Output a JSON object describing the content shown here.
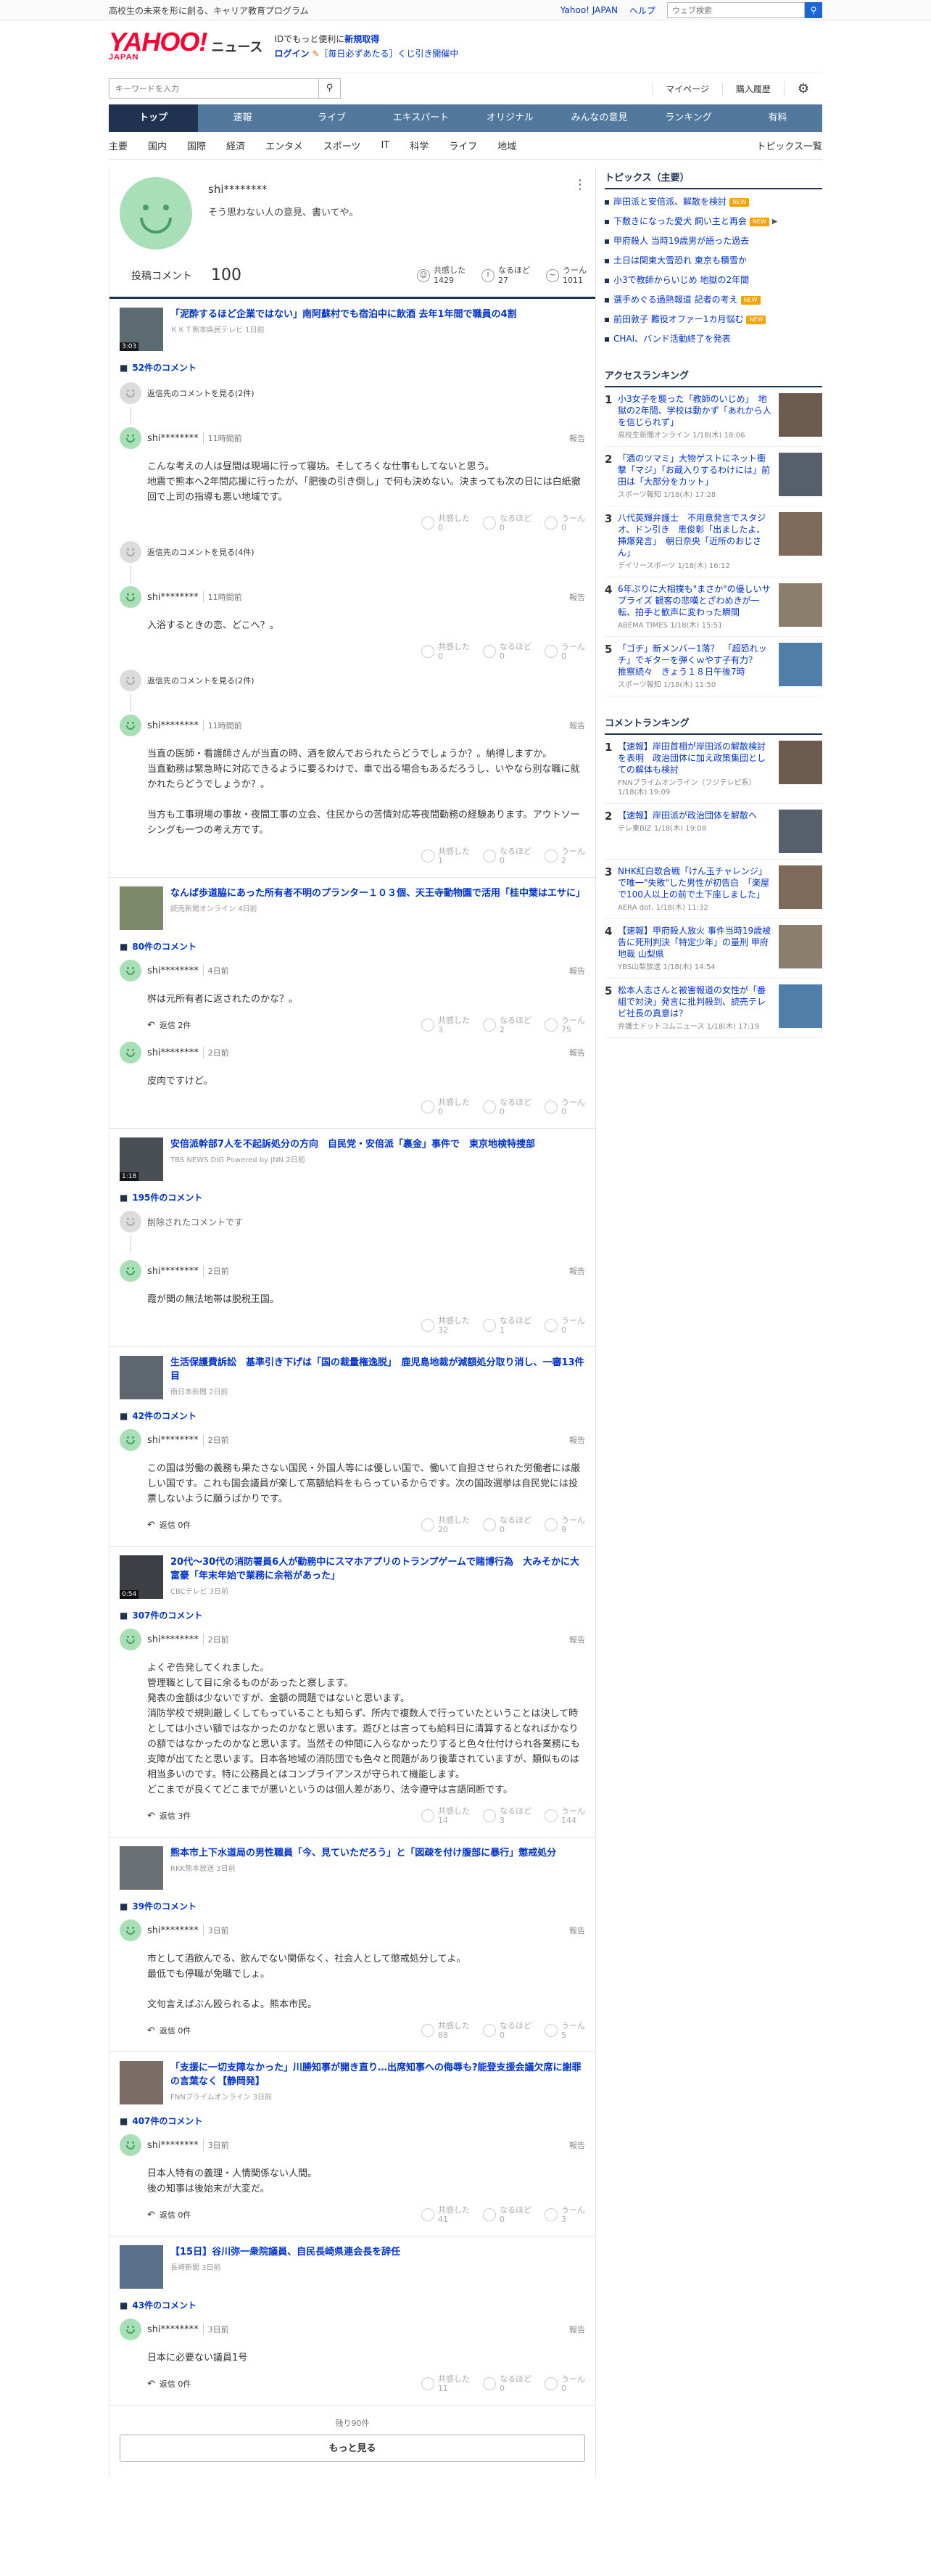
{
  "topbar": {
    "promo": "高校生の未来を形に創る、キャリア教育プログラム",
    "yahoo_japan": "Yahoo! JAPAN",
    "help": "ヘルプ",
    "search_placeholder": "ウェブ検索",
    "search_icon": "search-icon"
  },
  "header": {
    "logo": "YAHOO!",
    "logo_sub": "JAPAN",
    "service": "ニュース",
    "line1_pre": "IDでもっと便利に",
    "line1_link": "新規取得",
    "line2_login": "ログイン",
    "line2_rest": "［毎日必ずあたる］くじ引き開催中"
  },
  "utility": {
    "keyword_placeholder": "キーワードを入力",
    "mypage": "マイページ",
    "follow": "購入履歴",
    "settings_icon": "gear-icon"
  },
  "nav": [
    "トップ",
    "速報",
    "ライブ",
    "エキスパート",
    "オリジナル",
    "みんなの意見",
    "ランキング",
    "有料"
  ],
  "subnav": [
    "主要",
    "国内",
    "国際",
    "経済",
    "エンタメ",
    "スポーツ",
    "IT",
    "科学",
    "ライフ",
    "地域"
  ],
  "subnav_all": "トピックス一覧",
  "profile": {
    "name": "shi********",
    "desc": "そう思わない人の意見、書いてや。"
  },
  "stats": {
    "label": "投稿コメント",
    "count": "100",
    "r1": "共感した",
    "r1v": "1429",
    "r2": "なるほど",
    "r2v": "27",
    "r3": "うーん",
    "r3v": "1011"
  },
  "labels": {
    "report": "報告",
    "r1": "共感した",
    "r2": "なるほど",
    "r3": "うーん",
    "see_replies": "返信先のコメントを見る"
  },
  "blocks": [
    {
      "title": "「泥酔するほど企業ではない」南阿蘇村でも宿泊中に飲酒 去年1年間で職員の4割",
      "source": "ＫＫＴ熊本県民テレビ 1日前",
      "video": "3:03",
      "count": "52件のコメント",
      "thumb": "#5c6a72",
      "comments": [
        {
          "parent": "返信先のコメントを見る(2件)",
          "name": "shi********",
          "time": "11時間前",
          "body": "こんな考えの人は昼間は現場に行って寝坊。そしてろくな仕事もしてないと思う。\n地震で熊本へ2年間応援に行ったが、「肥後の引き倒し」で何も決めない。決まっても次の日には白紙撤回で上司の指導も悪い地域です。",
          "reply": "",
          "v1": "0",
          "v2": "0",
          "v3": "0"
        },
        {
          "parent": "返信先のコメントを見る(4件)",
          "name": "shi********",
          "time": "11時間前",
          "body": "入浴するときの恋、どこへ？。",
          "reply": "",
          "v1": "0",
          "v2": "0",
          "v3": "0"
        },
        {
          "parent": "返信先のコメントを見る(2件)",
          "name": "shi********",
          "time": "11時間前",
          "body": "当直の医師・看護師さんが当直の時、酒を飲んでおられたらどうでしょうか？。納得しますか。\n当直勤務は緊急時に対応できるように要るわけで、車で出る場合もあるだろうし、いやなら別な職に就かれたらどうでしょうか？。\n\n当方も工事現場の事故・夜間工事の立会、住民からの苦情対応等夜間勤務の経験あります。アウトソーシングも一つの考え方です。",
          "reply": "",
          "v1": "1",
          "v2": "0",
          "v3": "2"
        }
      ]
    },
    {
      "title": "なんば歩道脇にあった所有者不明のプランター１０３個、天王寺動物園で活用「桂中葉はエサに」",
      "source": "読売新聞オンライン 4日前",
      "video": "",
      "count": "80件のコメント",
      "thumb": "#7c8a6b",
      "comments": [
        {
          "parent": "",
          "name": "shi********",
          "time": "4日前",
          "body": "桝は元所有者に返されたのかな？。",
          "reply": "返信 2件",
          "v1": "3",
          "v2": "2",
          "v3": "75"
        },
        {
          "parent": "",
          "name": "shi********",
          "time": "2日前",
          "body": "皮肉ですけど。",
          "reply": "",
          "v1": "0",
          "v2": "0",
          "v3": "0"
        }
      ]
    },
    {
      "title": "安倍派幹部7人を不起訴処分の方向　自民党・安倍派「裏金」事件で　東京地検特捜部",
      "source": "TBS NEWS DIG Powered by JNN 2日前",
      "video": "1:18",
      "count": "195件のコメント",
      "thumb": "#4a4f55",
      "deleted": "削除されたコメントです",
      "comments": [
        {
          "parent": "",
          "name": "shi********",
          "time": "2日前",
          "body": "霞が関の無法地帯は脱税王国。",
          "reply": "",
          "v1": "32",
          "v2": "1",
          "v3": "0"
        }
      ]
    },
    {
      "title": "生活保護費訴訟　基準引き下げは「国の裁量権逸脱」　鹿児島地裁が減額処分取り消し、一審13件目",
      "source": "南日本新聞 2日前",
      "video": "",
      "count": "42件のコメント",
      "thumb": "#5e6670",
      "comments": [
        {
          "parent": "",
          "name": "shi********",
          "time": "2日前",
          "body": "この国は労働の義務も果たさない国民・外国人等には優しい国で、働いて自担させられた労働者には厳しい国です。これも国会議員が楽して高額給料をもらっているからです。次の国政選挙は自民党には投票しないように願うばかりです。",
          "reply": "返信 0件",
          "v1": "20",
          "v2": "0",
          "v3": "9"
        }
      ]
    },
    {
      "title": "20代〜30代の消防署員6人が勤務中にスマホアプリのトランプゲームで賭博行為　大みそかに大富豪「年末年始で業務に余裕があった」",
      "source": "CBCテレビ 3日前",
      "video": "0:54",
      "count": "307件のコメント",
      "thumb": "#3c3f44",
      "comments": [
        {
          "parent": "",
          "name": "shi********",
          "time": "2日前",
          "body": "よくぞ告発してくれました。\n管理職として目に余るものがあったと察します。\n発表の金額は少ないですが、金額の問題ではないと思います。\n消防学校で規則厳しくしてもっていることも知らず、所内で複数人で行っていたということは決して時としては小さい額ではなかったのかなと思います。遊びとは言っても給料日に清算するとなればかなりの額ではなかったのかなと思います。当然その仲間に入らなかったりすると色々仕付けられ各業務にも支障が出てたと思います。日本各地域の消防団でも色々と問題があり後輩されていますが、類似ものは相当多いのです。特に公務員とはコンプライアンスが守られて機能します。\nどこまでが良くてどこまでが悪いというのは個人差があり、法令遵守は言語同断です。",
          "reply": "返信 3件",
          "v1": "14",
          "v2": "3",
          "v3": "144"
        }
      ]
    },
    {
      "title": "熊本市上下水道局の男性職員「今、見ていただろう」と「図疎を付け腹部に暴行」懲戒処分",
      "source": "RKK熊本放送 3日前",
      "video": "",
      "count": "39件のコメント",
      "thumb": "#6b7075",
      "comments": [
        {
          "parent": "",
          "name": "shi********",
          "time": "3日前",
          "body": "市として酒飲んでる、飲んでない関係なく、社会人として懲戒処分してよ。\n最低でも停職が免職でしょ。\n\n文句言えばぶん殴られるよ。熊本市民。",
          "reply": "返信 0件",
          "v1": "88",
          "v2": "0",
          "v3": "5"
        }
      ]
    },
    {
      "title": "「支援に一切支障なかった」川勝知事が開き直り…出席知事への侮辱も?能登支援会議欠席に謝罪の言葉なく【静岡発】",
      "source": "FNNプライムオンライン 3日前",
      "video": "",
      "count": "407件のコメント",
      "thumb": "#7a6e66",
      "comments": [
        {
          "parent": "",
          "name": "shi********",
          "time": "3日前",
          "body": "日本人特有の義理・人情関係ない人間。\n後の知事は後始末が大変だ。",
          "reply": "返信 0件",
          "v1": "41",
          "v2": "0",
          "v3": "3"
        }
      ]
    },
    {
      "title": "【15日】谷川弥一衆院議員、自民長崎県連会長を辞任",
      "source": "長崎新聞 3日前",
      "video": "",
      "count": "43件のコメント",
      "thumb": "#58708a",
      "comments": [
        {
          "parent": "",
          "name": "shi********",
          "time": "3日前",
          "body": "日本に必要ない議員1号",
          "reply": "返信 0件",
          "v1": "11",
          "v2": "0",
          "v3": "0"
        }
      ]
    }
  ],
  "more": {
    "remaining": "残り90件",
    "button": "もっと見る"
  },
  "side": {
    "topics_head": "トピックス（主要）",
    "topics": [
      {
        "t": "岸田派と安倍派、解散を検討",
        "new": "NEW",
        "vid": ""
      },
      {
        "t": "下敷きになった愛犬 飼い主と再会",
        "new": "NEW",
        "vid": "▶"
      },
      {
        "t": "甲府殺人 当時19歳男が語った過去",
        "new": "",
        "vid": ""
      },
      {
        "t": "土日は関東大雪恐れ 東京も積雪か",
        "new": "",
        "vid": ""
      },
      {
        "t": "小3で教師からいじめ 地獄の2年間",
        "new": "",
        "vid": ""
      },
      {
        "t": "選手めぐる過熱報道 記者の考え",
        "new": "NEW",
        "vid": ""
      },
      {
        "t": "前田敦子 難役オファー1カ月悩む",
        "new": "NEW",
        "vid": ""
      },
      {
        "t": "CHAI、バンド活動終了を発表",
        "new": "",
        "vid": ""
      }
    ],
    "access_head": "アクセスランキング",
    "access": [
      {
        "t": "小3女子を襲った「教師のいじめ」　地獄の2年間、学校は動かず「あれから人を信じられず」",
        "s": "高校生新聞オンライン 1/18(木) 18:06"
      },
      {
        "t": "「酒のツマミ」大物ゲストにネット衝撃「マジ」「お蔵入りするわけには」前田は「大部分をカット」",
        "s": "スポーツ報知 1/18(木) 17:28"
      },
      {
        "t": "八代英輝弁護士　不用意発言でスタジオ、ドン引き　恵俊彰「出ましたよ、挿爆発言」　朝日奈央「近所のおじさん」",
        "s": "デイリースポーツ 1/18(木) 16:12"
      },
      {
        "t": "6年ぶりに大相撲も\"まさか\"の優しいサプライズ 観客の悲嘆とざわめきが一転、拍手と歓声に変わった瞬間",
        "s": "ABEMA TIMES 1/18(木) 15:51"
      },
      {
        "t": "「ゴチ」新メンバー1落？　「超恐れッチ」でギターを弾くｗやす子有力？　推察続々　きょう１８日午後7時",
        "s": "スポーツ報知 1/18(木) 11:50"
      }
    ],
    "comment_head": "コメントランキング",
    "crank": [
      {
        "t": "【速報】岸田首相が岸田派の解散検討を表明　政治団体に加え政策集団としての解体も検討",
        "s": "FNNプライムオンライン（フジテレビ系） 1/18(木) 19:09"
      },
      {
        "t": "【速報】岸田派が政治団体を解散へ",
        "s": "テレ東BIZ 1/18(木) 19:08"
      },
      {
        "t": "NHK紅白歌合戦「けん玉チャレンジ」で唯一\"失敗\"した男性が初告白　「楽屋で100人以上の前で土下座しました」",
        "s": "AERA dot. 1/18(木) 11:32"
      },
      {
        "t": "【速報】甲府殺人放火 事件当時19歳被告に死刑判決「特定少年」の量刑 甲府地裁 山梨県",
        "s": "YBS山梨放送 1/18(木) 14:54"
      },
      {
        "t": "松本人志さんと被害報道の女性が「番組で対決」発言に批判殺到、読売テレビ社長の真意は？",
        "s": "弁護士ドットコムニュース 1/18(木) 17:19"
      }
    ]
  },
  "colors": {
    "nav": "#52789d",
    "nav_active": "#1f3350",
    "link": "#0033cc",
    "logo": "#ff0033",
    "face": "#a8dfb7"
  }
}
